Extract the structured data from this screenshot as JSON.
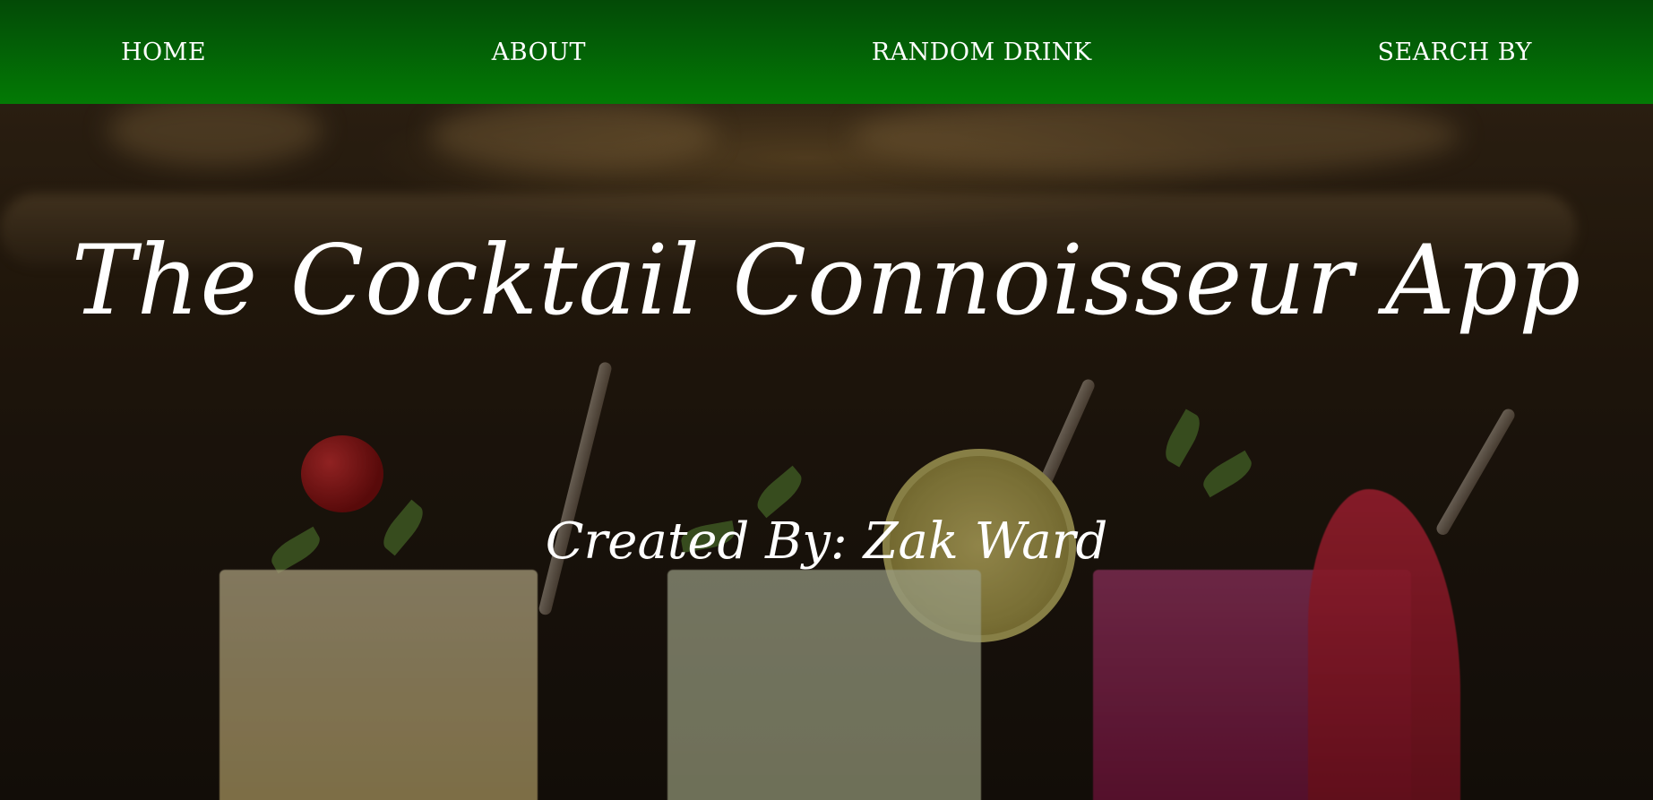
{
  "nav": {
    "items": [
      {
        "label": "HOME"
      },
      {
        "label": "ABOUT"
      },
      {
        "label": "RANDOM DRINK"
      },
      {
        "label": "SEARCH BY"
      }
    ]
  },
  "hero": {
    "title": "The Cocktail Connoisseur App",
    "subtitle": "Created By: Zak Ward",
    "background_image": "cocktail glasses photo"
  },
  "colors": {
    "nav_top": "#034a06",
    "nav_bottom": "#037a05",
    "text": "#ffffff"
  }
}
